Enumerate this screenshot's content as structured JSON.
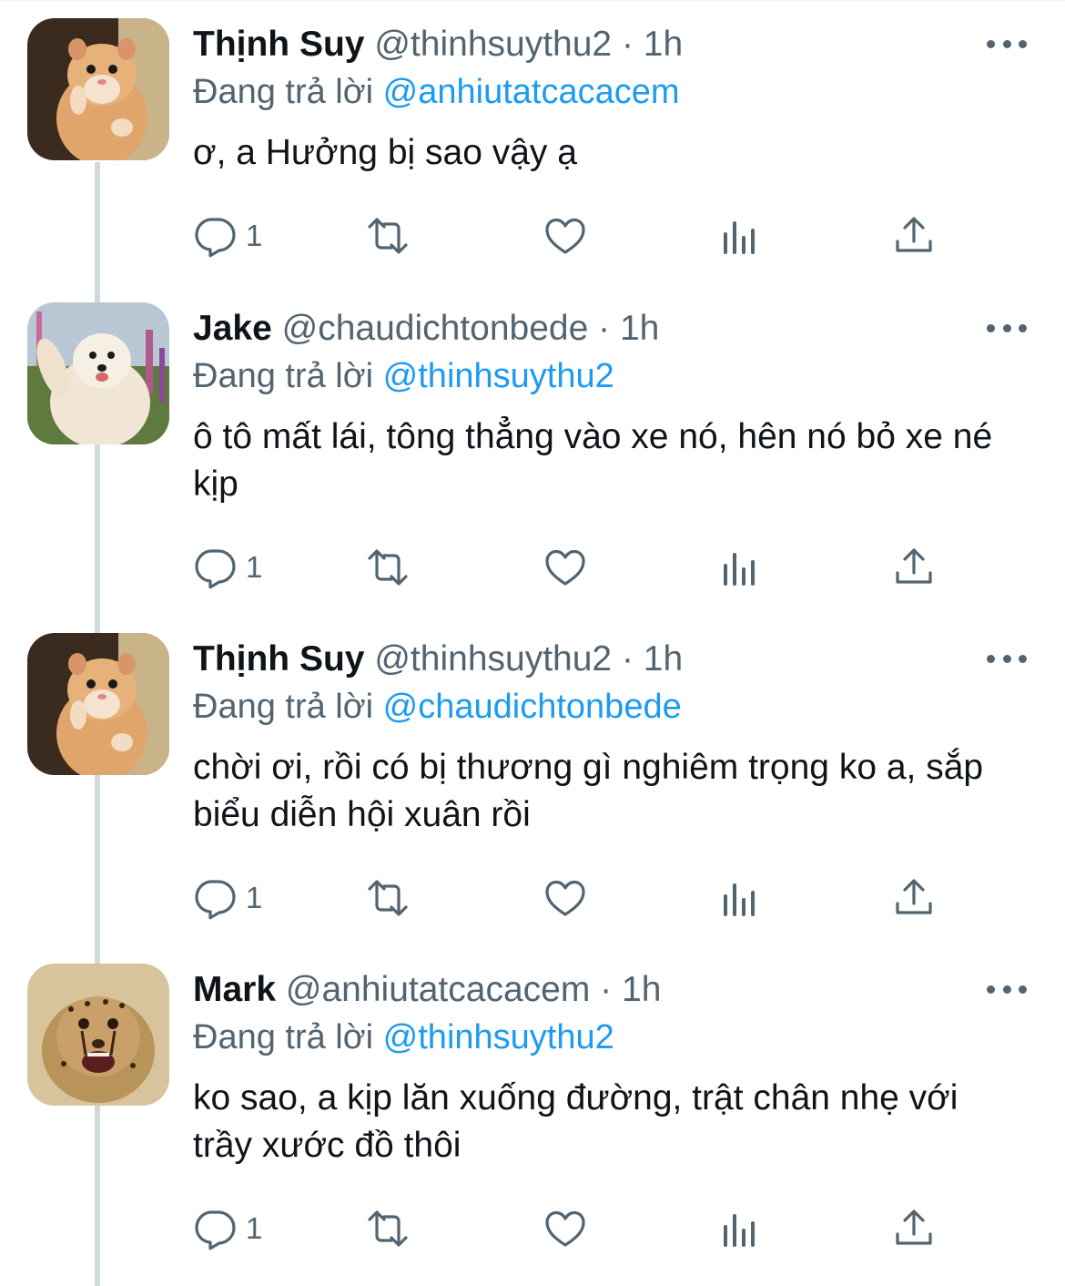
{
  "reply_prefix": "Đang trả lời",
  "colors": {
    "accent": "#1d9bf0",
    "secondary_text": "#536471",
    "thread_line": "#cfd9de"
  },
  "icons": [
    "reply-icon",
    "retweet-icon",
    "like-icon",
    "views-icon",
    "share-icon",
    "more-icon"
  ],
  "tweets": [
    {
      "name": "Thịnh Suy",
      "handle": "@thinhsuythu2",
      "dot": "·",
      "time": "1h",
      "reply_to": "@anhiutatcacacem",
      "text": "ơ, a Hưởng bị sao vậy ạ",
      "reply_count": "1",
      "avatar": "hamster"
    },
    {
      "name": "Jake",
      "handle": "@chaudichtonbede",
      "dot": "·",
      "time": "1h",
      "reply_to": "@thinhsuythu2",
      "text": "ô tô mất lái, tông thẳng vào xe nó, hên nó bỏ xe né kịp",
      "reply_count": "1",
      "avatar": "dog"
    },
    {
      "name": "Thịnh Suy",
      "handle": "@thinhsuythu2",
      "dot": "·",
      "time": "1h",
      "reply_to": "@chaudichtonbede",
      "text": "chời ơi, rồi có bị thương gì nghiêm trọng ko a, sắp biểu diễn hội xuân rồi",
      "reply_count": "1",
      "avatar": "hamster"
    },
    {
      "name": "Mark",
      "handle": "@anhiutatcacacem",
      "dot": "·",
      "time": "1h",
      "reply_to": "@thinhsuythu2",
      "text": "ko sao, a kịp lăn xuống đường, trật chân nhẹ với trầy xước đồ thôi",
      "reply_count": "1",
      "avatar": "cheetah"
    }
  ]
}
